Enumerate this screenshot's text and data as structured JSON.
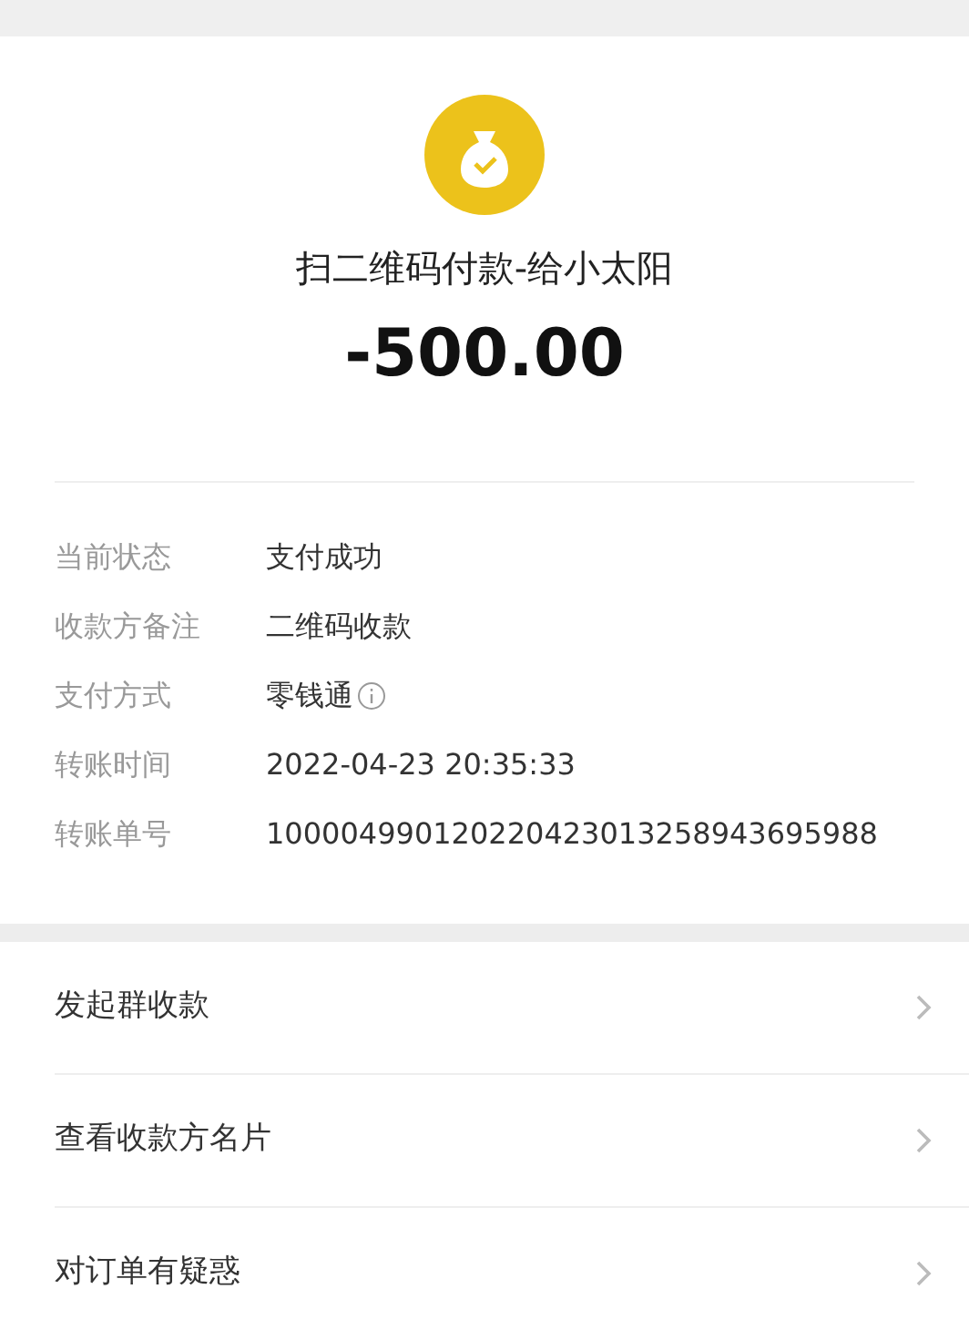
{
  "payment": {
    "title": "扫二维码付款-给小太阳",
    "amount": "-500.00"
  },
  "details": [
    {
      "label": "当前状态",
      "value": "支付成功",
      "info": false
    },
    {
      "label": "收款方备注",
      "value": "二维码收款",
      "info": false
    },
    {
      "label": "支付方式",
      "value": "零钱通",
      "info": true
    },
    {
      "label": "转账时间",
      "value": "2022-04-23 20:35:33",
      "info": false
    },
    {
      "label": "转账单号",
      "value": "100004990120220423013258943695988",
      "info": false
    }
  ],
  "actions": [
    {
      "label": "发起群收款"
    },
    {
      "label": "查看收款方名片"
    },
    {
      "label": "对订单有疑惑"
    }
  ]
}
